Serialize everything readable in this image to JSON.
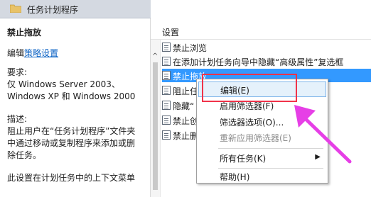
{
  "left_pane": {
    "header_title": "任务计划程序",
    "policy_name": "禁止拖放",
    "edit_prefix": "编辑",
    "edit_link": "策略设置",
    "requirements_label": "要求:",
    "requirements_lines": [
      "仅 Windows Server 2003、",
      "Windows XP 和 Windows 2000"
    ],
    "description_label": "描述:",
    "description_lines": [
      "阻止用户在“任务计划程序”文件夹",
      "中通过移动或复制程序来添加或删",
      "除任务。"
    ],
    "extra_line": "此设置在计划任务中的上下文菜单"
  },
  "right_pane": {
    "column_header": "设置",
    "rows": [
      {
        "label": "禁止浏览"
      },
      {
        "label": "在添加计划任务向导中隐藏“高级属性”复选框"
      },
      {
        "label": "禁止拖放"
      },
      {
        "label": "阻止任"
      },
      {
        "label": "隐藏“"
      },
      {
        "label": "禁止创"
      },
      {
        "label": "禁止删"
      }
    ],
    "selected_index": 2
  },
  "context_menu": {
    "items": [
      {
        "label": "编辑(E)",
        "enabled": true,
        "highlighted": true
      },
      {
        "label": "启用筛选器(F)",
        "enabled": true
      },
      {
        "label": "筛选器选项(O)...",
        "enabled": true
      },
      {
        "label": "重新应用筛选器(E)",
        "enabled": false
      },
      {
        "label": "所有任务(K)",
        "enabled": true,
        "submenu": true
      },
      {
        "label": "帮助(H)",
        "enabled": true
      }
    ],
    "submenu_arrow": "▶"
  },
  "scroll_up_glyph": "^",
  "colors": {
    "selection": "#3399ff",
    "link": "#0b62c4",
    "annotation_box": "#f0334a",
    "annotation_arrow": "#e63fe6"
  }
}
